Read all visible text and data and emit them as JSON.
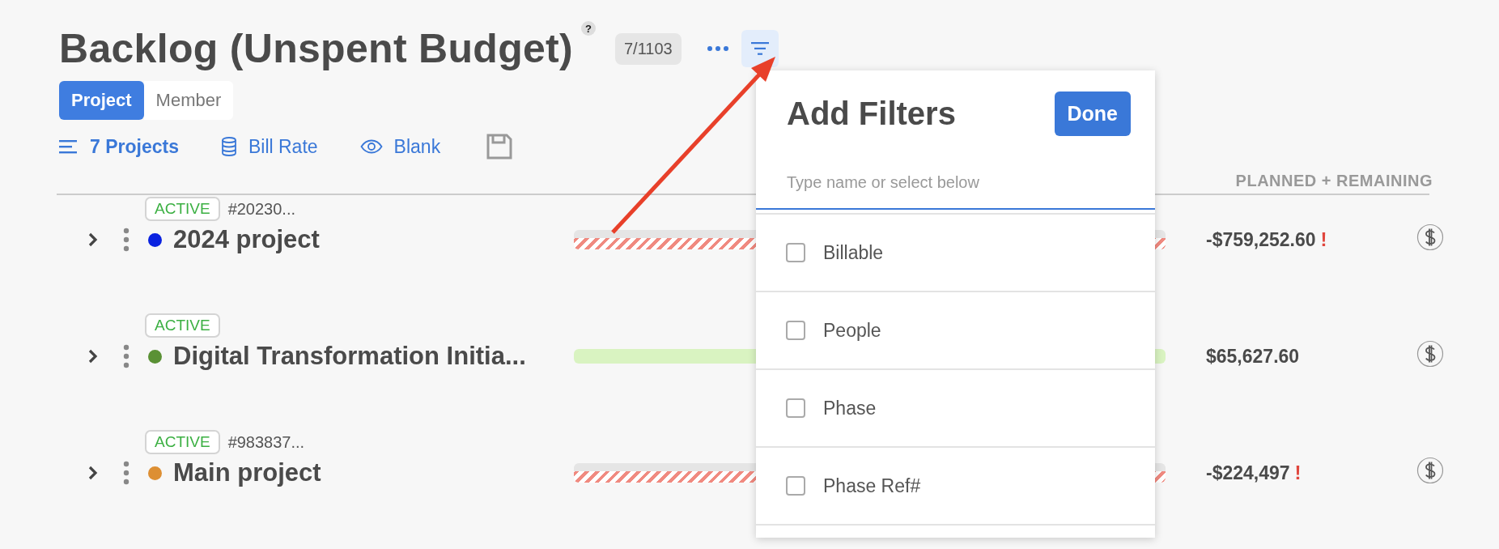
{
  "page": {
    "title": "Backlog (Unspent Budget)",
    "help": "?",
    "count": "7/1103"
  },
  "view_tabs": [
    {
      "label": "Project",
      "selected": true
    },
    {
      "label": "Member",
      "selected": false
    }
  ],
  "toolbar": [
    {
      "kind": "list",
      "label": "7 Projects"
    },
    {
      "kind": "rate",
      "label": "Bill Rate"
    },
    {
      "kind": "eye",
      "label": "Blank"
    },
    {
      "kind": "save"
    }
  ],
  "table": {
    "columns": [
      {
        "label": "PLANNED + REMAINING"
      }
    ],
    "rows": [
      {
        "status": "ACTIVE",
        "ref": "#20230...",
        "name": "2024 project",
        "color": "#0a22e0",
        "over_budget": true,
        "amount": "-$759,252.60",
        "warning": "!"
      },
      {
        "status": "ACTIVE",
        "name": "Digital Transformation Initia...",
        "color": "#5a9135",
        "over_budget": false,
        "amount": "$65,627.60"
      },
      {
        "status": "ACTIVE",
        "ref": "#983837...",
        "name": "Main project",
        "color": "#dd8f33",
        "over_budget": true,
        "amount": "-$224,497",
        "warning": "!"
      }
    ]
  },
  "filter_panel": {
    "title": "Add Filters",
    "done": "Done",
    "placeholder": "Type name or select below",
    "options": [
      {
        "label": "Billable",
        "checked": false
      },
      {
        "label": "People",
        "checked": false
      },
      {
        "label": "Phase",
        "checked": false
      },
      {
        "label": "Phase Ref#",
        "checked": false
      }
    ]
  }
}
